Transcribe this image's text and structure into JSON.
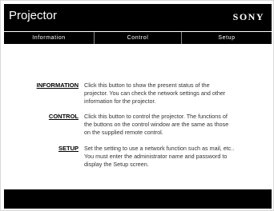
{
  "header": {
    "title": "Projector",
    "brand": "SONY"
  },
  "nav": {
    "tabs": [
      {
        "label": "Information"
      },
      {
        "label": "Control"
      },
      {
        "label": "Setup"
      }
    ]
  },
  "descriptions": [
    {
      "link": "INFORMATION",
      "lines": [
        "Click this button to show the present status of the",
        "projector. You can check the network settings and other",
        "information for the projector."
      ]
    },
    {
      "link": "CONTROL",
      "lines": [
        "Click this button to control the projector. The functions of",
        "the buttons on the control window are the same as those",
        "on the supplied remote control."
      ]
    },
    {
      "link": "SETUP",
      "lines": [
        "Set the setting to use a network function such as mail, etc..",
        "You must enter the administrator name and password to",
        "display the Setup screen."
      ]
    }
  ],
  "colors": {
    "bar_background": "#000000",
    "page_background": "#ffffff",
    "body_text": "#333333",
    "tab_divider": "#8a8a8a"
  }
}
